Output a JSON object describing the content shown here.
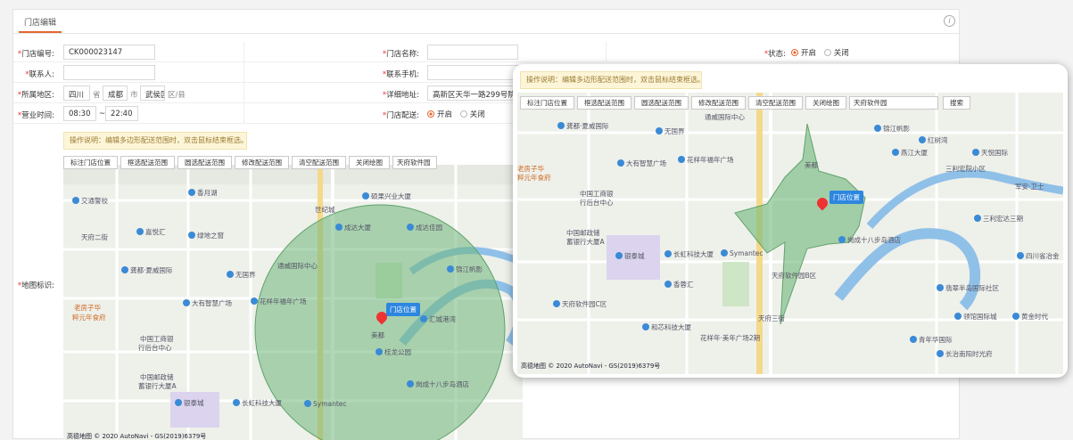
{
  "tab": {
    "label": "门店编辑"
  },
  "info_icon": "i",
  "form": {
    "store_no": {
      "label": "门店编号:",
      "value": "CK000023147"
    },
    "store_name": {
      "label": "门店名称:",
      "value": ""
    },
    "status": {
      "label": "状态:",
      "on": "开启",
      "off": "关闭"
    },
    "contact": {
      "label": "联系人:",
      "value": ""
    },
    "phone": {
      "label": "联系手机:",
      "value": ""
    },
    "region": {
      "label": "所属地区:",
      "province": "四川",
      "province_unit": "省",
      "city": "成都",
      "city_unit": "市",
      "district": "武侯区",
      "district_unit": "区/县"
    },
    "address": {
      "label": "详细地址:",
      "value": "高新区天华一路299号院"
    },
    "hours": {
      "label": "营业时间:",
      "start": "08:30",
      "sep": "~",
      "end": "22:40"
    },
    "delivery": {
      "label": "门店配送:",
      "on": "开启",
      "off": "关闭"
    },
    "map_mark": {
      "label": "地图标识:"
    }
  },
  "map": {
    "notice": "操作说明：编辑多边形配送范围时，双击鼠标结束框选。",
    "toolbar": [
      "标注门店位置",
      "框选配送范围",
      "圆选配送范围",
      "修改配送范围",
      "清空配送范围",
      "关闭绘图"
    ],
    "search_value": "天府软件园",
    "search_button": "搜索",
    "pin_label": "门店位置",
    "copyright": "高德地图 © 2020 AutoNavi - GS(2019)6379号",
    "pois": [
      "交通警校",
      "嘉悦汇",
      "香月湖",
      "绿地之窗",
      "龚都·夏威国际",
      "无国界",
      "大有智慧广场",
      "花样年福年广场",
      "老房子华",
      "粹元年食府",
      "中国工商银",
      "行后台中心",
      "中国邮政储",
      "蓄银行大厦A",
      "银泰城",
      "长虹科技大厦",
      "天府二街",
      "成达大厦",
      "成达佳园",
      "通威国际中心",
      "锦江帆影",
      "汇城港湾",
      "桂龙公园",
      "岗成十八步岛酒店",
      "Symantec",
      "美都",
      "硕果兴业大厦",
      "世纪城"
    ],
    "popup_pois": [
      "龚都·夏威国际",
      "无国界",
      "大有智慧广场",
      "花样年福年广场",
      "老房子华",
      "粹元年食府",
      "中国工商银",
      "行后台中心",
      "中国邮政储",
      "蓄银行大厦A",
      "银泰城",
      "长虹科技大厦",
      "Symantec",
      "香蓉汇",
      "天府软件园B区",
      "天府软件园C区",
      "和芯科技大厦",
      "花样年·美年广场2期",
      "锦江帆影",
      "红树湾",
      "天悦国际",
      "三利宏达三期",
      "军安·卫士",
      "四川省冶金",
      "翡翠半岛国际社区",
      "领馆国际城",
      "黄金时代",
      "长治南阳时光府",
      "青年华国际",
      "岗成十八步岛酒店",
      "通威国际中心",
      "美都",
      "天府三街",
      "三利宏院小区",
      "燕江大厦"
    ]
  },
  "colors": {
    "accent": "#e4672e",
    "zone": "#6fb77a",
    "pin": "#e33333",
    "pin_label": "#2d86e0"
  }
}
